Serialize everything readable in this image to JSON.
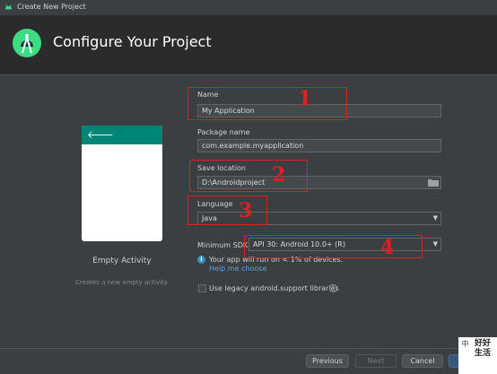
{
  "window": {
    "title": "Create New Project"
  },
  "header": {
    "title": "Configure Your Project"
  },
  "template": {
    "name": "Empty Activity",
    "description": "Creates a new empty activity.",
    "back_glyph": "🡐"
  },
  "form": {
    "name": {
      "label": "Name",
      "value": "My Application"
    },
    "package": {
      "label": "Package name",
      "value": "com.example.myapplication"
    },
    "location": {
      "label": "Save location",
      "value": "D:\\Androidproject"
    },
    "language": {
      "label": "Language",
      "value": "Java"
    },
    "min_sdk": {
      "label": "Minimum SDK",
      "value": "API 30: Android 10.0+ (R)"
    },
    "info": {
      "text": "Your app will run on < 1% of devices.",
      "link": "Help me choose"
    },
    "legacy": {
      "label": "Use legacy android.support libraries"
    }
  },
  "buttons": {
    "previous": "Previous",
    "next": "Next",
    "cancel": "Cancel"
  },
  "annotations": [
    "1",
    "2",
    "3",
    "4"
  ],
  "watermark": {
    "side": "中",
    "main": "好好生活"
  },
  "colors": {
    "accent_green": "#3ddc84",
    "appbar": "#008577",
    "annotation_red": "#e02020",
    "link": "#589df6"
  },
  "icons": {
    "dropdown": "chevron-down-icon",
    "folder": "folder-icon",
    "info": "info-icon",
    "help": "question-icon"
  }
}
